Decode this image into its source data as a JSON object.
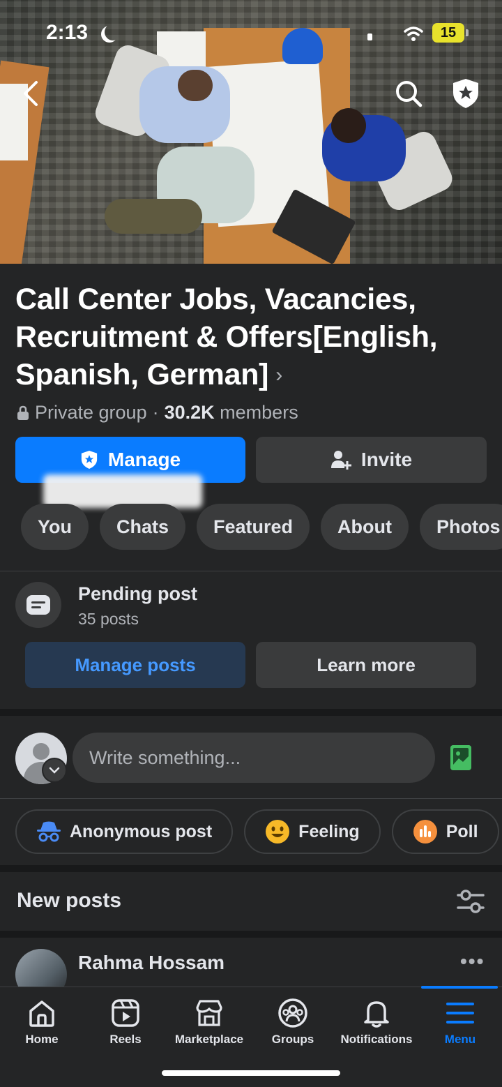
{
  "status_bar": {
    "time": "2:13",
    "battery": "15"
  },
  "group": {
    "title": "Call Center Jobs, Vacancies, Recruitment & Offers[English, Spanish, German]",
    "privacy": "Private group",
    "separator": "·",
    "members_count": "30.2K",
    "members_label": "members"
  },
  "actions": {
    "manage": "Manage",
    "invite": "Invite"
  },
  "tabs": [
    "You",
    "Chats",
    "Featured",
    "About",
    "Photos"
  ],
  "pending": {
    "title": "Pending post",
    "subtitle": "35 posts",
    "manage_posts": "Manage posts",
    "learn_more": "Learn more"
  },
  "composer": {
    "placeholder": "Write something..."
  },
  "post_options": [
    "Anonymous post",
    "Feeling",
    "Poll"
  ],
  "feed": {
    "section_title": "New posts"
  },
  "post": {
    "author": "Rahma Hossam"
  },
  "bottom_nav": [
    {
      "label": "Home",
      "icon": "home-icon"
    },
    {
      "label": "Reels",
      "icon": "reels-icon"
    },
    {
      "label": "Marketplace",
      "icon": "marketplace-icon"
    },
    {
      "label": "Groups",
      "icon": "groups-icon"
    },
    {
      "label": "Notifications",
      "icon": "bell-icon"
    },
    {
      "label": "Menu",
      "icon": "menu-icon",
      "active": true
    }
  ],
  "colors": {
    "accent": "#0a7cff",
    "background": "#242526",
    "surface": "#3a3b3c"
  }
}
